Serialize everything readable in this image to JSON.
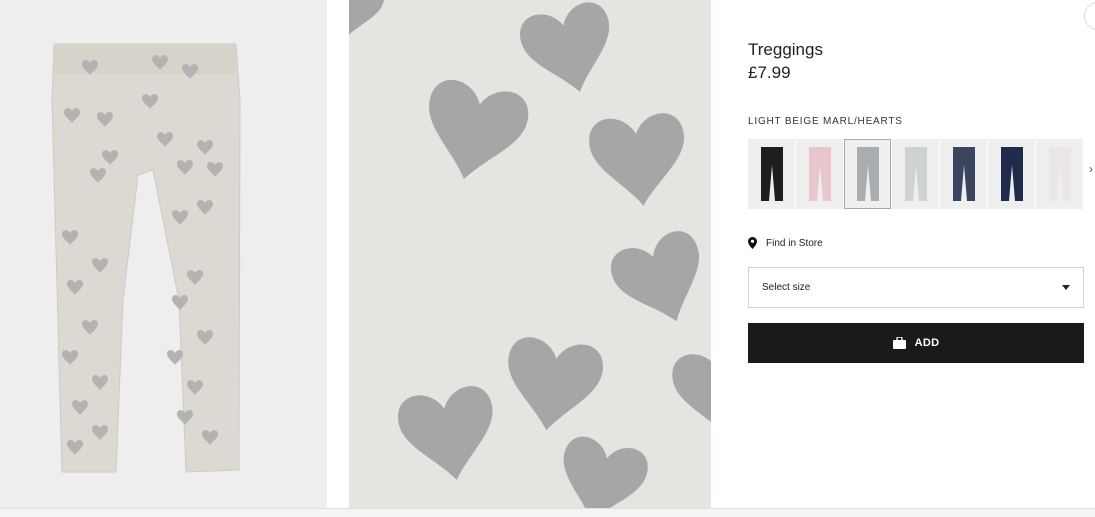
{
  "product": {
    "name": "Treggings",
    "price": "£7.99",
    "color_name": "LIGHT BEIGE MARL/HEARTS"
  },
  "swatches": [
    {
      "label": "black",
      "color": "#1e1e1e",
      "selected": false
    },
    {
      "label": "light pink",
      "color": "#e8c6cc",
      "selected": false
    },
    {
      "label": "grey print",
      "color": "#a9acb1",
      "selected": true
    },
    {
      "label": "white floral",
      "color": "#cfd3cf",
      "selected": false
    },
    {
      "label": "navy print",
      "color": "#3b4560",
      "selected": false
    },
    {
      "label": "dark blue",
      "color": "#1f2a4d",
      "selected": false
    },
    {
      "label": "white print",
      "color": "#ece6ea",
      "selected": false
    }
  ],
  "store": {
    "find_label": "Find in Store"
  },
  "size": {
    "placeholder": "Select size"
  },
  "add_button": {
    "label": "ADD"
  },
  "colors": {
    "button_bg": "#1a1a1a",
    "image_bg": "#eeeeee",
    "fabric": "#e6e4e0",
    "heart": "#a4a4a4"
  }
}
